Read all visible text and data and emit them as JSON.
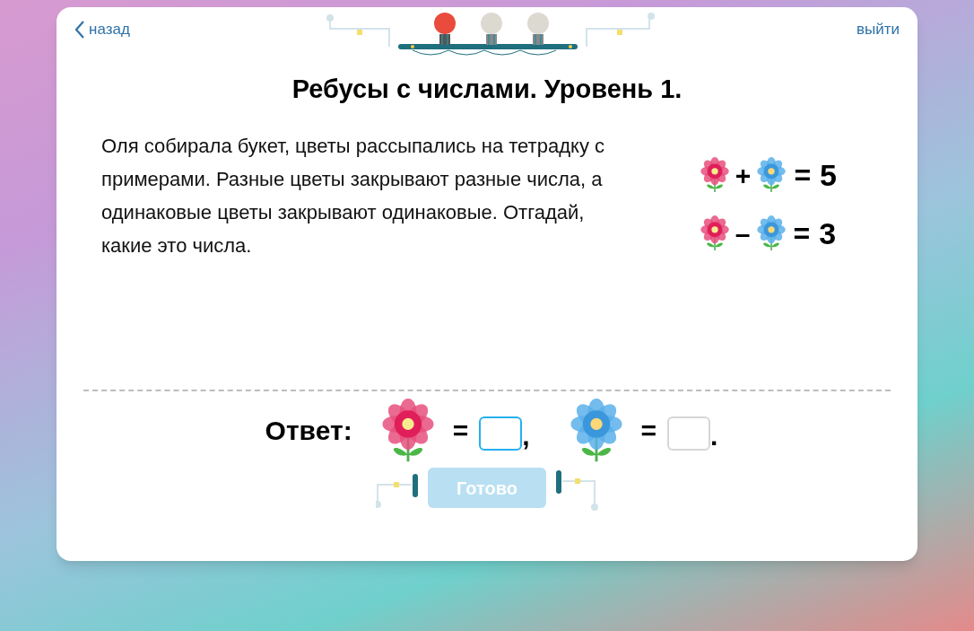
{
  "nav": {
    "back": "назад",
    "exit": "выйти"
  },
  "progress": [
    {
      "lit": true
    },
    {
      "lit": false
    },
    {
      "lit": false
    }
  ],
  "title": "Ребусы с числами. Уровень 1.",
  "problem": "Оля собирала букет, цветы рассыпались на тетрадку с примерами. Разные цветы закрывают разные числа, а одинаковые цветы закрывают одинаковые. Отгадай, какие это числа.",
  "equations": [
    {
      "left": {
        "kind": "red"
      },
      "op": "+",
      "right": {
        "kind": "blue"
      },
      "eq": "=",
      "result": "5"
    },
    {
      "left": {
        "kind": "red"
      },
      "op": "–",
      "right": {
        "kind": "blue"
      },
      "eq": "=",
      "result": "3"
    }
  ],
  "answer": {
    "label": "Ответ:",
    "items": [
      {
        "kind": "red",
        "eq": "=",
        "focused": true,
        "punct": ","
      },
      {
        "kind": "blue",
        "eq": "=",
        "focused": false,
        "punct": "."
      }
    ]
  },
  "submit": {
    "label": "Готово",
    "disabled": true
  }
}
